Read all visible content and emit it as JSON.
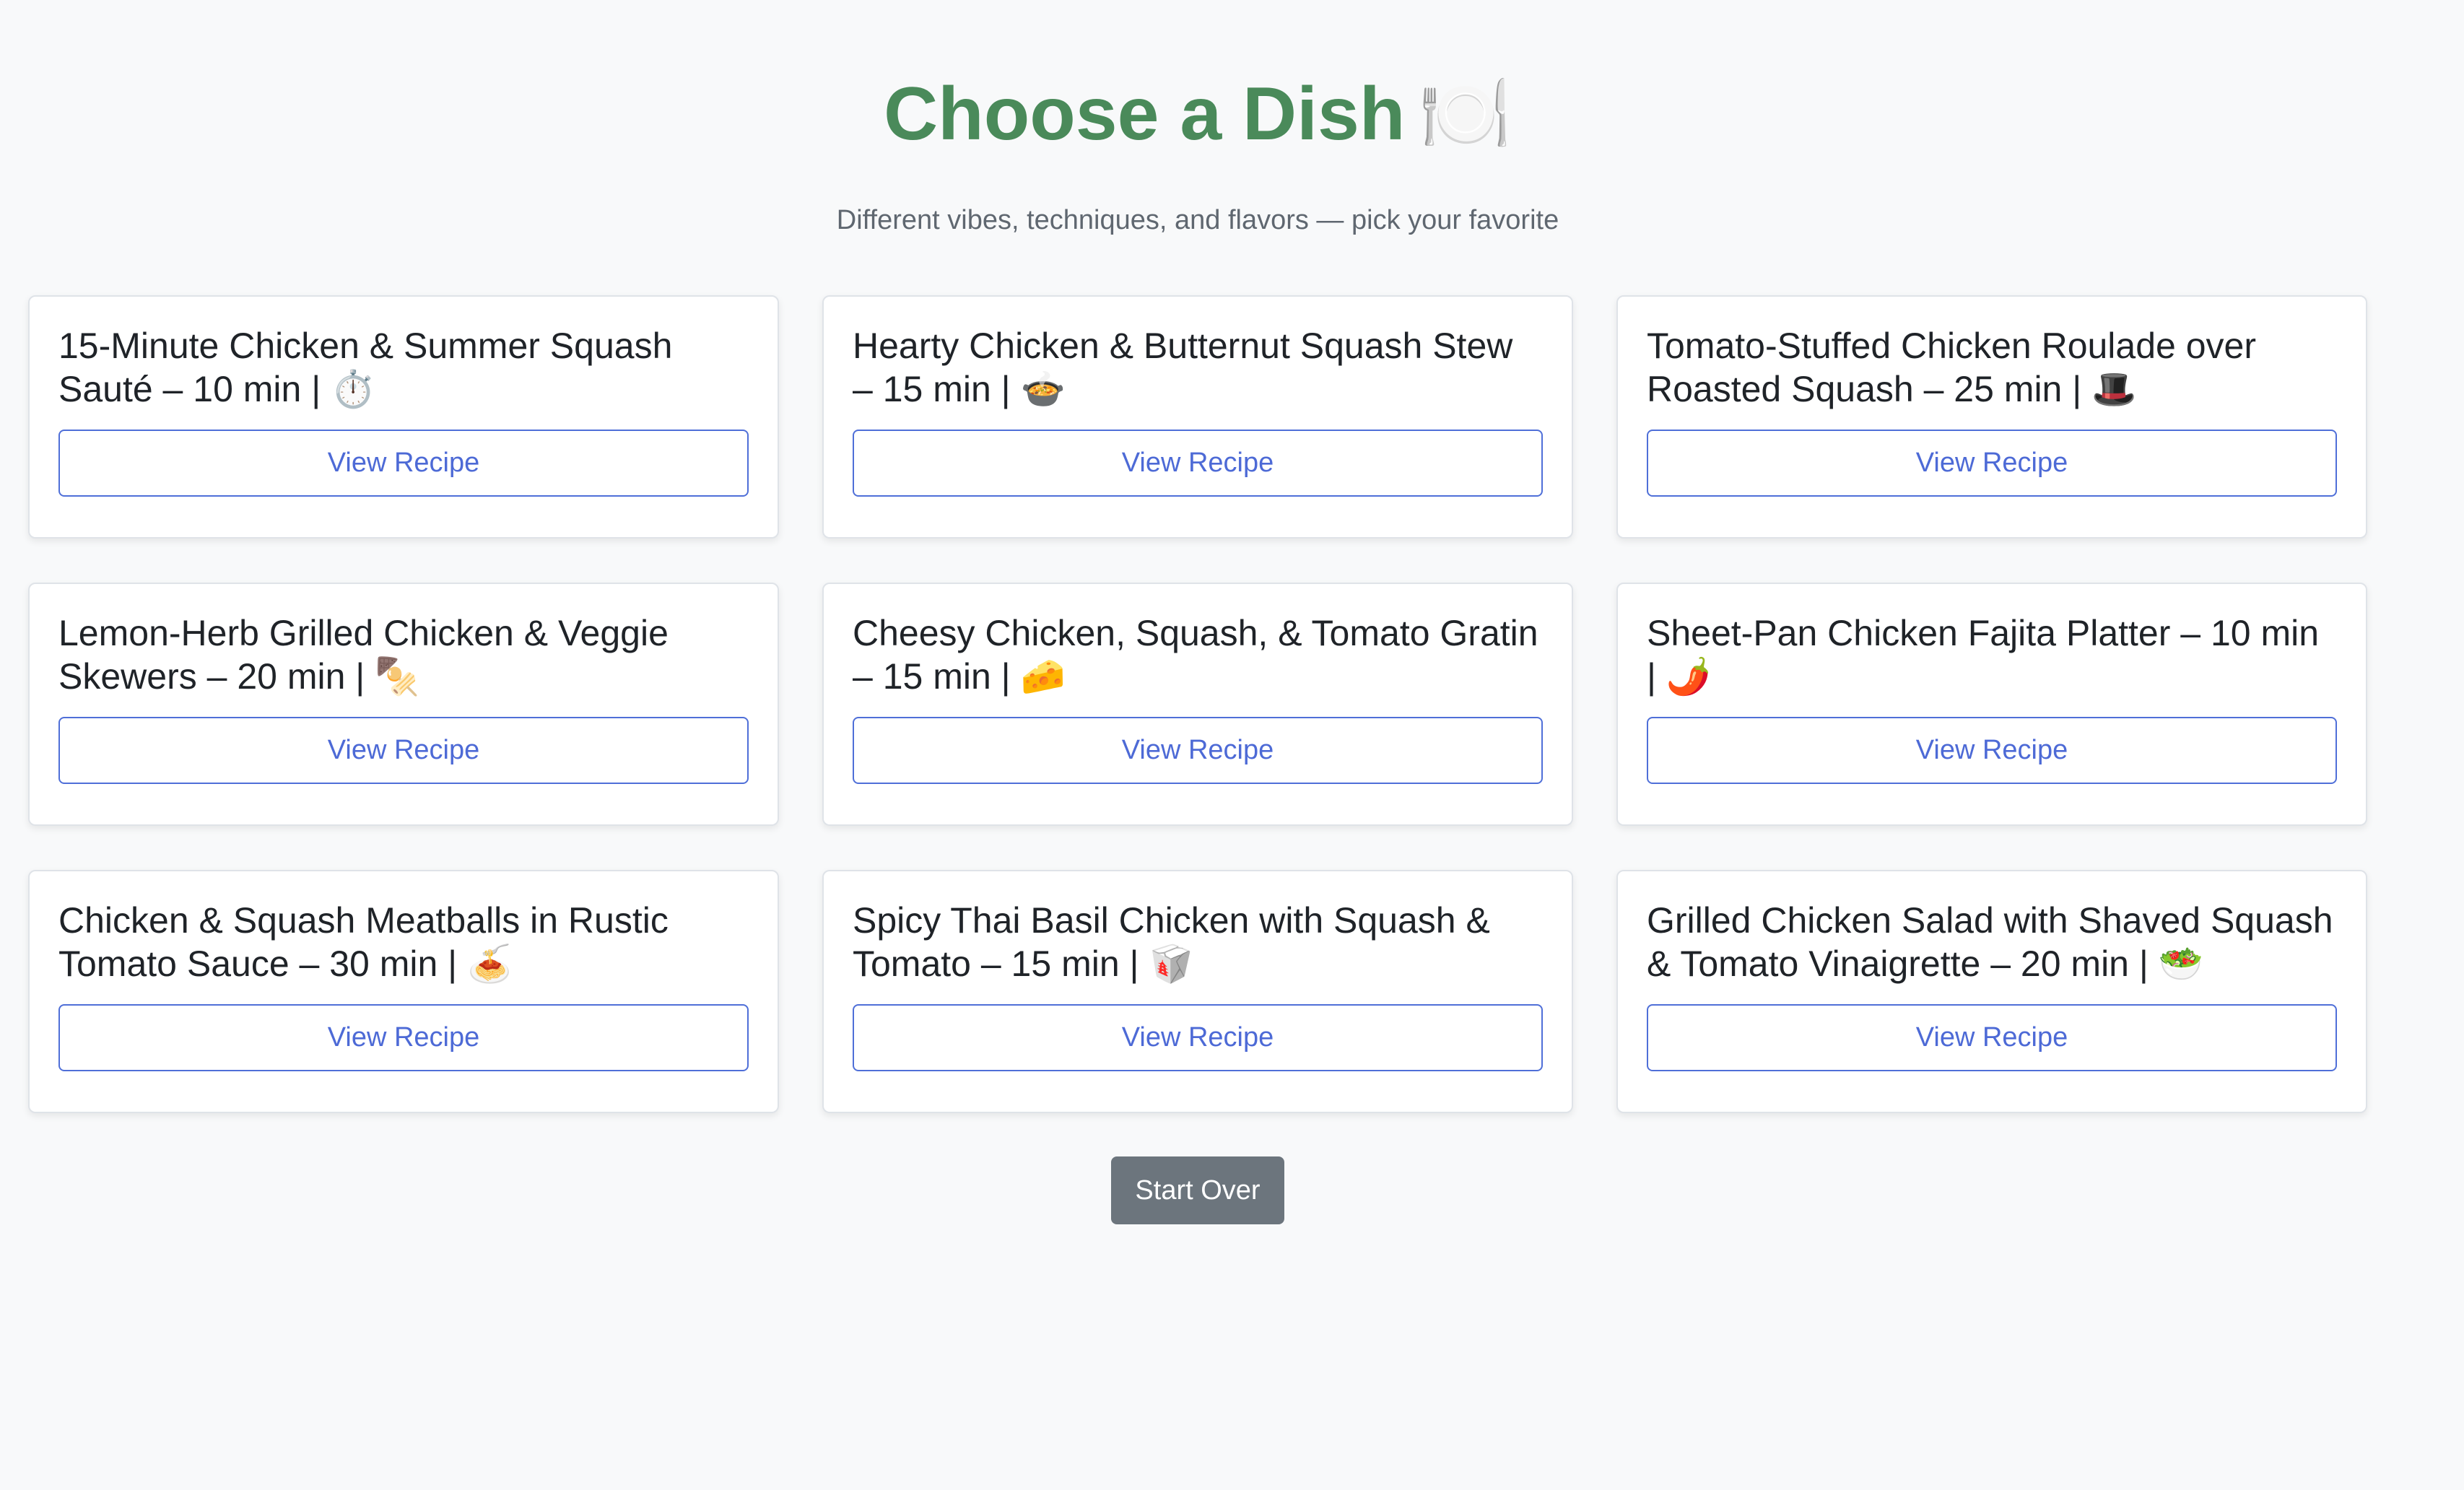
{
  "header": {
    "title": "Choose a Dish",
    "title_emoji": "🍽️",
    "subtitle": "Different vibes, techniques, and flavors — pick your favorite"
  },
  "dishes": [
    {
      "title": "15-Minute Chicken & Summer Squash Sauté – 10 min | ⏱️",
      "button_label": "View Recipe"
    },
    {
      "title": "Hearty Chicken & Butternut Squash Stew – 15 min | 🍲",
      "button_label": "View Recipe"
    },
    {
      "title": "Tomato-Stuffed Chicken Roulade over Roasted Squash – 25 min | 🎩",
      "button_label": "View Recipe"
    },
    {
      "title": "Lemon-Herb Grilled Chicken & Veggie Skewers – 20 min | 🍢",
      "button_label": "View Recipe"
    },
    {
      "title": "Cheesy Chicken, Squash, & Tomato Gratin – 15 min | 🧀",
      "button_label": "View Recipe"
    },
    {
      "title": "Sheet-Pan Chicken Fajita Platter – 10 min | 🌶️",
      "button_label": "View Recipe"
    },
    {
      "title": "Chicken & Squash Meatballs in Rustic Tomato Sauce – 30 min | 🍝",
      "button_label": "View Recipe"
    },
    {
      "title": "Spicy Thai Basil Chicken with Squash & Tomato – 15 min | 🥡",
      "button_label": "View Recipe"
    },
    {
      "title": "Grilled Chicken Salad with Shaved Squash & Tomato Vinaigrette – 20 min | 🥗",
      "button_label": "View Recipe"
    }
  ],
  "footer": {
    "start_over_label": "Start Over"
  },
  "colors": {
    "title": "#4a8a5a",
    "button_outline": "#4f6fd8",
    "start_over_bg": "#6c757d",
    "background": "#f8f9fa"
  }
}
